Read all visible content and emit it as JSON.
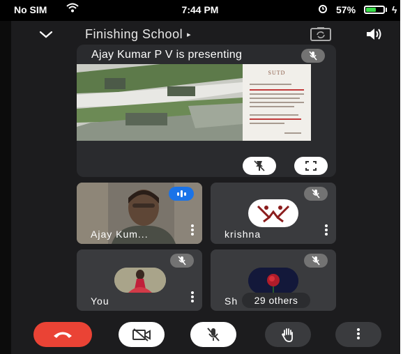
{
  "status_bar": {
    "carrier": "No SIM",
    "time": "7:44 PM",
    "battery_percent": "57%",
    "battery_level": 0.57,
    "battery_color": "#3adb4a"
  },
  "header": {
    "meeting_title": "Finishing School",
    "title_arrow": "▸",
    "icons": [
      "chevron-down-icon",
      "switch-camera-icon",
      "speaker-icon"
    ]
  },
  "presentation": {
    "label": "Ajay Kumar P V is presenting",
    "slide_heading": "SUTD",
    "controls": [
      "unpin-icon",
      "fullscreen-icon"
    ],
    "muted": true
  },
  "participants": [
    {
      "name": "Ajay Kum...",
      "speaking": true,
      "muted": false
    },
    {
      "name": "krishna",
      "speaking": false,
      "muted": true
    },
    {
      "name": "You",
      "speaking": false,
      "muted": true
    },
    {
      "name": "Sh",
      "speaking": false,
      "muted": true
    }
  ],
  "others_count_label": "29 others",
  "bottom_controls": [
    "end-call-icon",
    "camera-off-icon",
    "mic-off-icon",
    "raise-hand-icon",
    "more-options-icon"
  ],
  "colors": {
    "end_call": "#ea4335",
    "speaking_badge": "#1a73e8",
    "background": "#1c1c1e",
    "tile": "#3a3b3e"
  }
}
